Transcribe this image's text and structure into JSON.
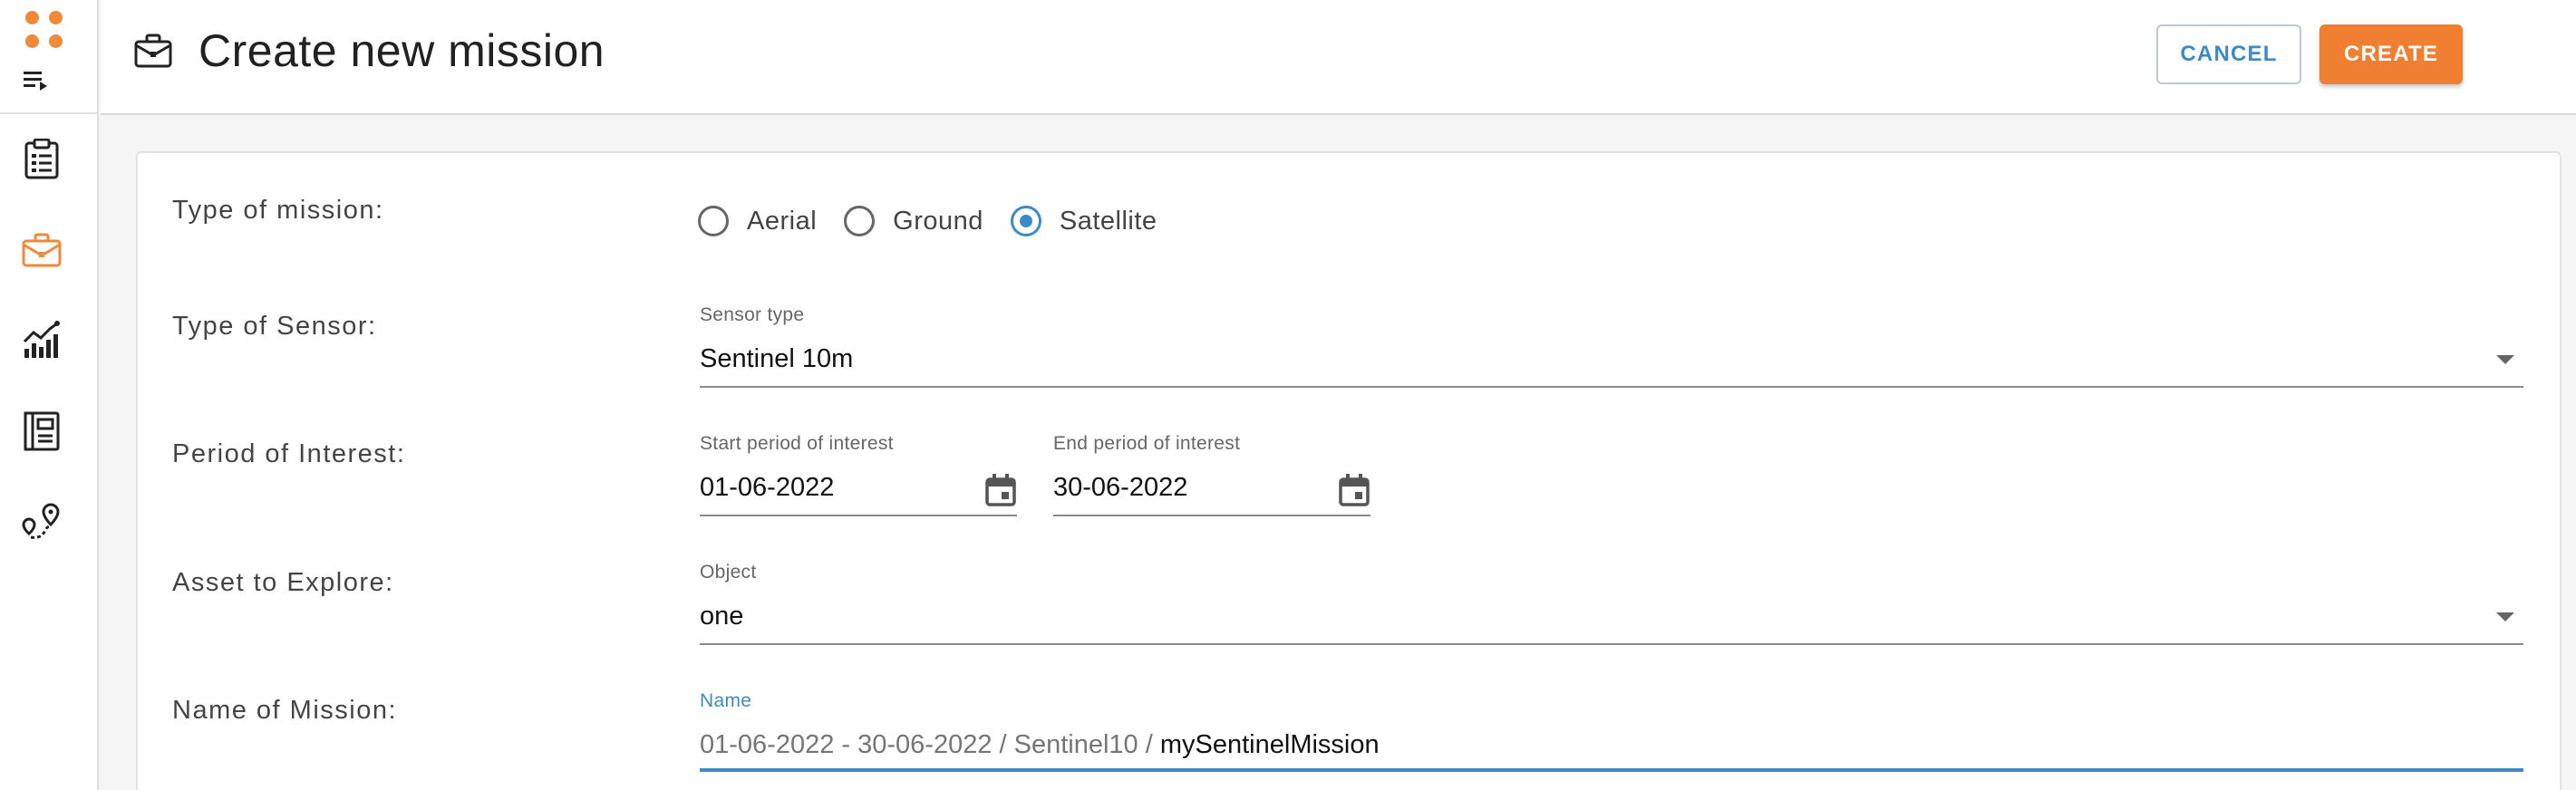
{
  "header": {
    "title": "Create new mission",
    "cancel_label": "CANCEL",
    "create_label": "CREATE"
  },
  "sidebar": {
    "items": [
      {
        "name": "clipboard-icon",
        "active": false
      },
      {
        "name": "briefcase-icon",
        "active": true
      },
      {
        "name": "chart-icon",
        "active": false
      },
      {
        "name": "report-icon",
        "active": false
      },
      {
        "name": "route-icon",
        "active": false
      }
    ]
  },
  "form": {
    "mission_type": {
      "label": "Type of mission:",
      "options": [
        "Aerial",
        "Ground",
        "Satellite"
      ],
      "selected": "Satellite"
    },
    "sensor": {
      "label": "Type of Sensor:",
      "field_label": "Sensor type",
      "value": "Sentinel 10m"
    },
    "period": {
      "label": "Period of Interest:",
      "start_label": "Start period of interest",
      "start_value": "01-06-2022",
      "end_label": "End period of interest",
      "end_value": "30-06-2022"
    },
    "asset": {
      "label": "Asset to Explore:",
      "field_label": "Object",
      "value": "one"
    },
    "name": {
      "label": "Name of Mission:",
      "field_label": "Name",
      "prefix": "01-06-2022 - 30-06-2022 / Sentinel10 /",
      "value": "mySentinelMission"
    }
  },
  "colors": {
    "accent": "#f07f32",
    "primary": "#3d8ac9",
    "text": "#212121"
  }
}
